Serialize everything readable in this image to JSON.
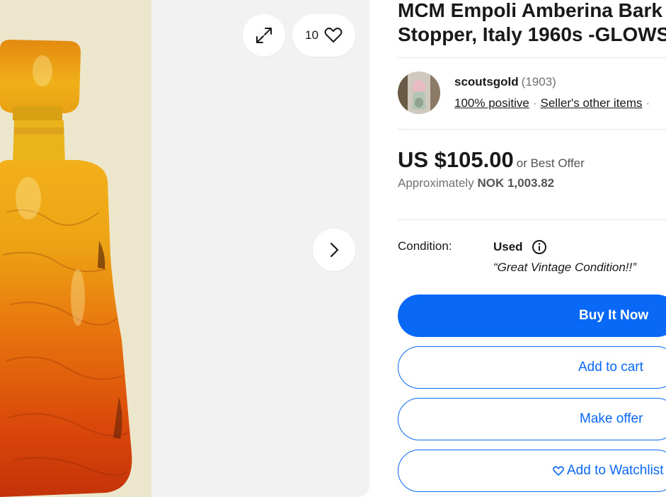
{
  "gallery": {
    "watch_count": "10",
    "icons": {
      "expand": "expand-icon",
      "heart": "heart-icon",
      "next": "chevron-right-icon"
    }
  },
  "listing": {
    "title_line1": "MCM Empoli Amberina Bark",
    "title_line2": "Stopper, Italy 1960s -GLOWS"
  },
  "seller": {
    "name": "scoutsgold",
    "score": "(1903)",
    "positive": "100% positive",
    "other_items": "Seller's other items"
  },
  "price": {
    "amount": "US $105.00",
    "best_offer": "or Best Offer",
    "approx_label": "Approximately",
    "approx_value": "NOK 1,003.82"
  },
  "condition": {
    "label": "Condition:",
    "value": "Used",
    "note": "“Great Vintage Condition!!”"
  },
  "actions": {
    "buy_now": "Buy It Now",
    "add_to_cart": "Add to cart",
    "make_offer": "Make offer",
    "add_to_watchlist": "Add to Watchlist"
  },
  "colors": {
    "accent": "#0968f6",
    "gallery_bg": "#f2f2f2",
    "text": "#191919"
  }
}
